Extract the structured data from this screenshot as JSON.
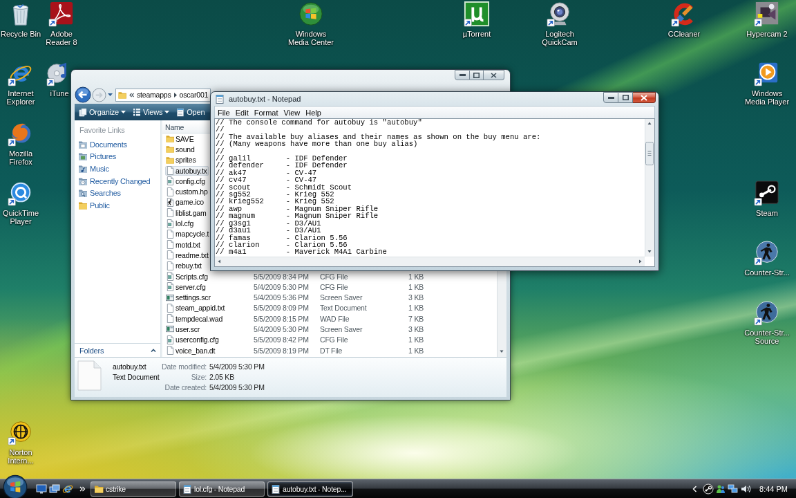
{
  "desktop": {
    "icons": [
      {
        "label": "Recycle Bin"
      },
      {
        "label": "Adobe Reader 8"
      },
      {
        "label": "Windows Media Center"
      },
      {
        "label": "µTorrent"
      },
      {
        "label": "Logitech QuickCam"
      },
      {
        "label": "CCleaner"
      },
      {
        "label": "Hypercam 2"
      },
      {
        "label": "Internet Explorer"
      },
      {
        "label": "iTune"
      },
      {
        "label": "Windows Media Player"
      },
      {
        "label": "Mozilla Firefox"
      },
      {
        "label": "QuickTime Player"
      },
      {
        "label": "Steam"
      },
      {
        "label": "Counter-Str..."
      },
      {
        "label": "Counter-Str... Source"
      },
      {
        "label": "Norton Intern..."
      }
    ]
  },
  "explorer": {
    "address_path": [
      "steamapps",
      "oscar001"
    ],
    "toolbar": [
      {
        "label": "Organize",
        "menu": true
      },
      {
        "label": "Views",
        "menu": true
      },
      {
        "label": "Open"
      }
    ],
    "favorite_links": {
      "title": "Favorite Links",
      "items": [
        "Documents",
        "Pictures",
        "Music",
        "Recently Changed",
        "Searches",
        "Public"
      ]
    },
    "folders_label": "Folders",
    "file_list": {
      "columns": [
        "Name"
      ],
      "rows": [
        {
          "name": "SAVE",
          "kind": "folder",
          "selected": false
        },
        {
          "name": "sound",
          "kind": "folder",
          "selected": false
        },
        {
          "name": "sprites",
          "kind": "folder",
          "selected": false
        },
        {
          "name": "autobuy.tx",
          "kind": "text",
          "selected": true
        },
        {
          "name": "config.cfg",
          "kind": "config",
          "selected": false
        },
        {
          "name": "custom.hp",
          "kind": "text",
          "selected": false
        },
        {
          "name": "game.ico",
          "kind": "image",
          "selected": false
        },
        {
          "name": "liblist.gam",
          "kind": "text",
          "selected": false
        },
        {
          "name": "lol.cfg",
          "kind": "config",
          "selected": false
        },
        {
          "name": "mapcycle.t",
          "kind": "text",
          "selected": false
        },
        {
          "name": "motd.txt",
          "kind": "text",
          "selected": false
        },
        {
          "name": "readme.txt",
          "kind": "text",
          "selected": false
        },
        {
          "name": "rebuy.txt",
          "kind": "text",
          "selected": false
        },
        {
          "name": "Scripts.cfg",
          "kind": "config",
          "selected": false,
          "date_modified": "5/5/2009 8:34 PM",
          "type": "CFG File",
          "size": "1 KB"
        },
        {
          "name": "server.cfg",
          "kind": "config",
          "selected": false,
          "date_modified": "5/4/2009 5:30 PM",
          "type": "CFG File",
          "size": "1 KB"
        },
        {
          "name": "settings.scr",
          "kind": "screensaver",
          "selected": false,
          "date_modified": "5/4/2009 5:36 PM",
          "type": "Screen Saver",
          "size": "3 KB"
        },
        {
          "name": "steam_appid.txt",
          "kind": "text",
          "selected": false,
          "date_modified": "5/5/2009 8:09 PM",
          "type": "Text Document",
          "size": "1 KB"
        },
        {
          "name": "tempdecal.wad",
          "kind": "text",
          "selected": false,
          "date_modified": "5/5/2009 8:15 PM",
          "type": "WAD File",
          "size": "7 KB"
        },
        {
          "name": "user.scr",
          "kind": "screensaver",
          "selected": false,
          "date_modified": "5/4/2009 5:30 PM",
          "type": "Screen Saver",
          "size": "3 KB"
        },
        {
          "name": "userconfig.cfg",
          "kind": "config",
          "selected": false,
          "date_modified": "5/5/2009 8:42 PM",
          "type": "CFG File",
          "size": "1 KB"
        },
        {
          "name": "voice_ban.dt",
          "kind": "text",
          "selected": false,
          "date_modified": "5/5/2009 8:19 PM",
          "type": "DT File",
          "size": "1 KB"
        }
      ]
    },
    "details": {
      "name": "autobuy.txt",
      "type": "Text Document",
      "fields": [
        {
          "label": "Date modified:",
          "value": "5/4/2009 5:30 PM"
        },
        {
          "label": "Size:",
          "value": "2.05 KB"
        },
        {
          "label": "Date created:",
          "value": "5/4/2009 5:30 PM"
        }
      ]
    }
  },
  "notepad": {
    "title": "autobuy.txt - Notepad",
    "menu": [
      "File",
      "Edit",
      "Format",
      "View",
      "Help"
    ],
    "lines": [
      "// The console command for autobuy is \"autobuy\"",
      "//",
      "// The available buy aliases and their names as shown on the buy menu are:",
      "// (Many weapons have more than one buy alias)",
      "//",
      "// galil        - IDF Defender",
      "// defender     - IDF Defender",
      "// ak47         - CV-47",
      "// cv47         - CV-47",
      "// scout        - Schmidt Scout",
      "// sg552        - Krieg 552",
      "// krieg552     - Krieg 552",
      "// awp          - Magnum Sniper Rifle",
      "// magnum       - Magnum Sniper Rifle",
      "// g3sg1        - D3/AU1",
      "// d3au1        - D3/AU1",
      "// famas        - Clarion 5.56",
      "// clarion      - Clarion 5.56",
      "// m4a1         - Maverick M4A1 Carbine"
    ]
  },
  "taskbar": {
    "tasks": [
      {
        "label": "cstrike",
        "kind": "folder",
        "selected": false
      },
      {
        "label": "lol.cfg - Notepad",
        "kind": "notepad",
        "selected": false
      },
      {
        "label": "autobuy.txt - Notep...",
        "kind": "notepad",
        "selected": true
      }
    ],
    "clock": "8:44 PM"
  }
}
